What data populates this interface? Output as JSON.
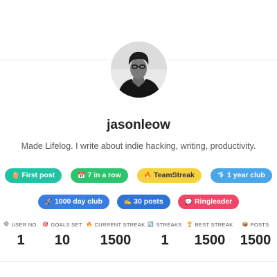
{
  "profile": {
    "username": "jasonleow",
    "bio": "Made Lifelog. I write about indie hacking, writing, productivity."
  },
  "badges_row1": [
    {
      "icon": "🥚",
      "label": "First post",
      "color": "#1fc4a4"
    },
    {
      "icon": "📅",
      "label": "7 in a row",
      "color": "#2ec46e"
    },
    {
      "icon": "🔥",
      "label": "TeamStreak",
      "color": "#f7d23f",
      "text_color": "#333333"
    },
    {
      "icon": "💎",
      "label": "1 year club",
      "color": "#4aa6e8"
    }
  ],
  "badges_row2": [
    {
      "icon": "🚀",
      "label": "1000 day club",
      "color": "#3a7de0"
    },
    {
      "icon": "✍️",
      "label": "30 posts",
      "color": "#2f73d6"
    },
    {
      "icon": "💬",
      "label": "Ringleader",
      "color": "#ef4566"
    }
  ],
  "stats": [
    {
      "icon": "🐵",
      "label": "USER NO.",
      "value": "1"
    },
    {
      "icon": "🎯",
      "label": "GOALS SET",
      "value": "10"
    },
    {
      "icon": "🔥",
      "label": "CURRENT STREAK",
      "value": "1500"
    },
    {
      "icon": "🔄",
      "label": "STREAKS",
      "value": "1"
    },
    {
      "icon": "🏆",
      "label": "BEST STREAK",
      "value": "1500"
    },
    {
      "icon": "📦",
      "label": "POSTS",
      "value": "1500"
    }
  ]
}
